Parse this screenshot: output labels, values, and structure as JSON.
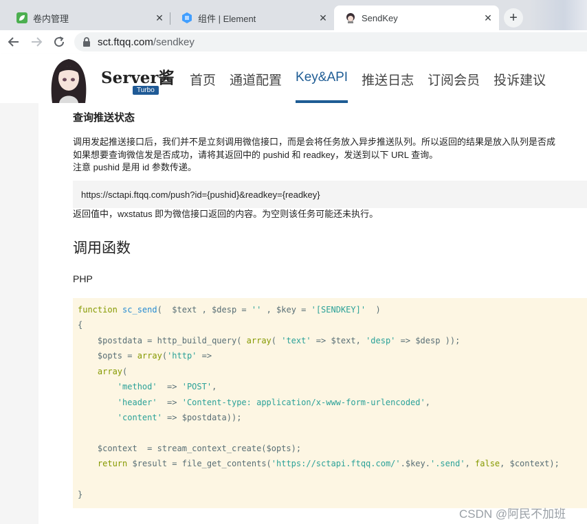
{
  "browser": {
    "tabs": [
      {
        "title": "卷内管理",
        "icon": "leaf-icon"
      },
      {
        "title": "组件 | Element",
        "icon": "element-icon"
      },
      {
        "title": "SendKey",
        "icon": "avatar-icon"
      }
    ],
    "url_host": "sct.ftqq.com",
    "url_path": "/sendkey"
  },
  "site": {
    "brand": "Server酱",
    "badge": "Turbo",
    "nav": [
      "首页",
      "通道配置",
      "Key&API",
      "推送日志",
      "订阅会员",
      "投诉建议"
    ],
    "active_nav": "Key&API"
  },
  "content": {
    "section_title": "查询推送状态",
    "para1": "调用发起推送接口后，我们并不是立刻调用微信接口，而是会将任务放入异步推送队列。所以返回的结果是放入队列是否成",
    "para2": "如果想要查询微信发是否成功，请将其返回中的 pushid 和 readkey，发送到以下 URL 查询。",
    "para3": "注意 pushid 是用 id 参数传递。",
    "query_url": "https://sctapi.ftqq.com/push?id={pushid}&readkey={readkey}",
    "para4": "返回值中，wxstatus 即为微信接口返回的内容。为空则该任务可能还未执行。",
    "h2": "调用函数",
    "lang": "PHP"
  },
  "watermark": "CSDN @阿民不加班",
  "colors": {
    "accent": "#1e5c94",
    "code_bg": "#fdf6e3",
    "keyword": "#859900",
    "string": "#2aa198",
    "function": "#268bd2"
  }
}
